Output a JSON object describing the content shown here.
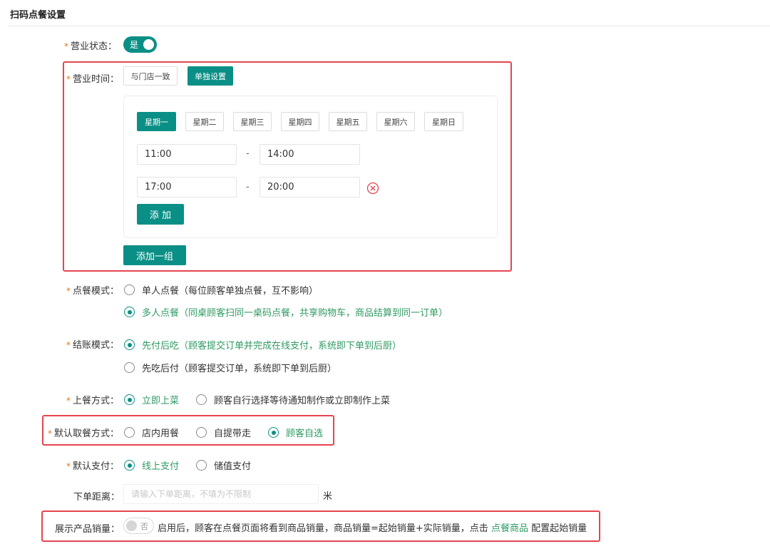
{
  "page": {
    "title": "扫码点餐设置"
  },
  "business_status": {
    "label": "营业状态：",
    "toggle_text": "是",
    "on": true
  },
  "business_hours": {
    "label": "营业时间：",
    "mode_same": "与门店一致",
    "mode_custom": "单独设置",
    "weekdays": [
      "星期一",
      "星期二",
      "星期三",
      "星期四",
      "星期五",
      "星期六",
      "星期日"
    ],
    "selected_day": "星期一",
    "slots": [
      {
        "start": "11:00",
        "end": "14:00"
      },
      {
        "start": "17:00",
        "end": "20:00"
      }
    ],
    "separator": "-",
    "add_button": "添 加",
    "add_group_button": "添加一组"
  },
  "order_mode": {
    "label": "点餐模式：",
    "options": [
      "单人点餐（每位顾客单独点餐，互不影响）",
      "多人点餐（同桌顾客扫同一桌码点餐，共享购物车，商品结算到同一订单）"
    ],
    "selected": 1
  },
  "checkout_mode": {
    "label": "结账模式：",
    "options": [
      "先付后吃（顾客提交订单并完成在线支付，系统即下单到后厨）",
      "先吃后付（顾客提交订单，系统即下单到后厨）"
    ],
    "selected": 0
  },
  "serving_mode": {
    "label": "上餐方式：",
    "options": [
      "立即上菜",
      "顾客自行选择等待通知制作或立即制作上菜"
    ],
    "selected": 0
  },
  "pickup_mode": {
    "label": "默认取餐方式：",
    "options": [
      "店内用餐",
      "自提带走",
      "顾客自选"
    ],
    "selected": 2
  },
  "payment_mode": {
    "label": "默认支付：",
    "options": [
      "线上支付",
      "储值支付"
    ],
    "selected": 0
  },
  "order_distance": {
    "label": "下单距离：",
    "placeholder": "请输入下单距离，不填为不限制",
    "value": "",
    "unit": "米"
  },
  "show_sales": {
    "label": "展示产品销量：",
    "toggle_text": "否",
    "on": false,
    "desc_before": "启用后，顾客在点餐页面将看到商品销量，商品销量=起始销量+实际销量，点击",
    "link": "点餐商品",
    "desc_after": "配置起始销量"
  },
  "colors": {
    "accent": "#0a8f86",
    "selected_text": "#2e9a62",
    "required": "#e0761f",
    "highlight": "#e5454e"
  },
  "icons": {
    "remove": "close-circle-icon"
  }
}
